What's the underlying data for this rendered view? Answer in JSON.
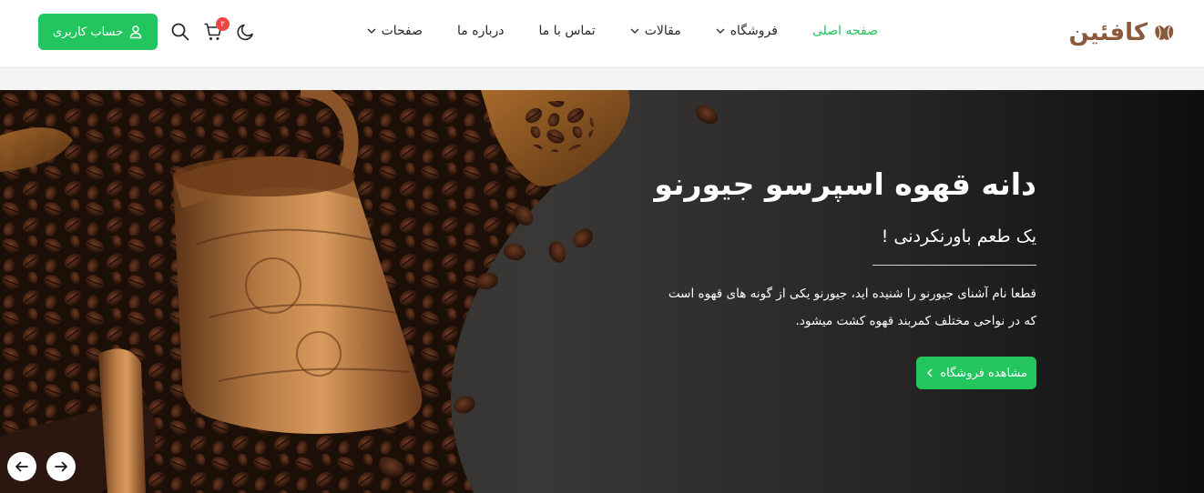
{
  "header": {
    "logo_text": "کافئین",
    "nav": [
      {
        "label": "صفحه اصلی",
        "active": true,
        "dropdown": false
      },
      {
        "label": "فروشگاه",
        "active": false,
        "dropdown": true
      },
      {
        "label": "مقالات",
        "active": false,
        "dropdown": true
      },
      {
        "label": "تماس با ما",
        "active": false,
        "dropdown": false
      },
      {
        "label": "درباره ما",
        "active": false,
        "dropdown": false
      },
      {
        "label": "صفحات",
        "active": false,
        "dropdown": true
      }
    ],
    "account_label": "حساب کاربری",
    "cart_count": "۲",
    "icons": [
      "moon-icon",
      "cart-icon",
      "search-icon",
      "user-icon"
    ]
  },
  "hero": {
    "title": "دانه قهوه اسپرسو جیورنو",
    "subtitle": "یک طعم باورنکردنی !",
    "description_line1": "قطعا نام آشنای جیورنو را شنیده اید، جیورنو یکی از گونه های قهوه است",
    "description_line2": "که در نواحی مختلف کمربند قهوه کشت میشود.",
    "cta_label": "مشاهده فروشگاه"
  },
  "colors": {
    "accent": "#22c55e",
    "brand": "#8b5a3c",
    "badge": "#ef4444"
  }
}
